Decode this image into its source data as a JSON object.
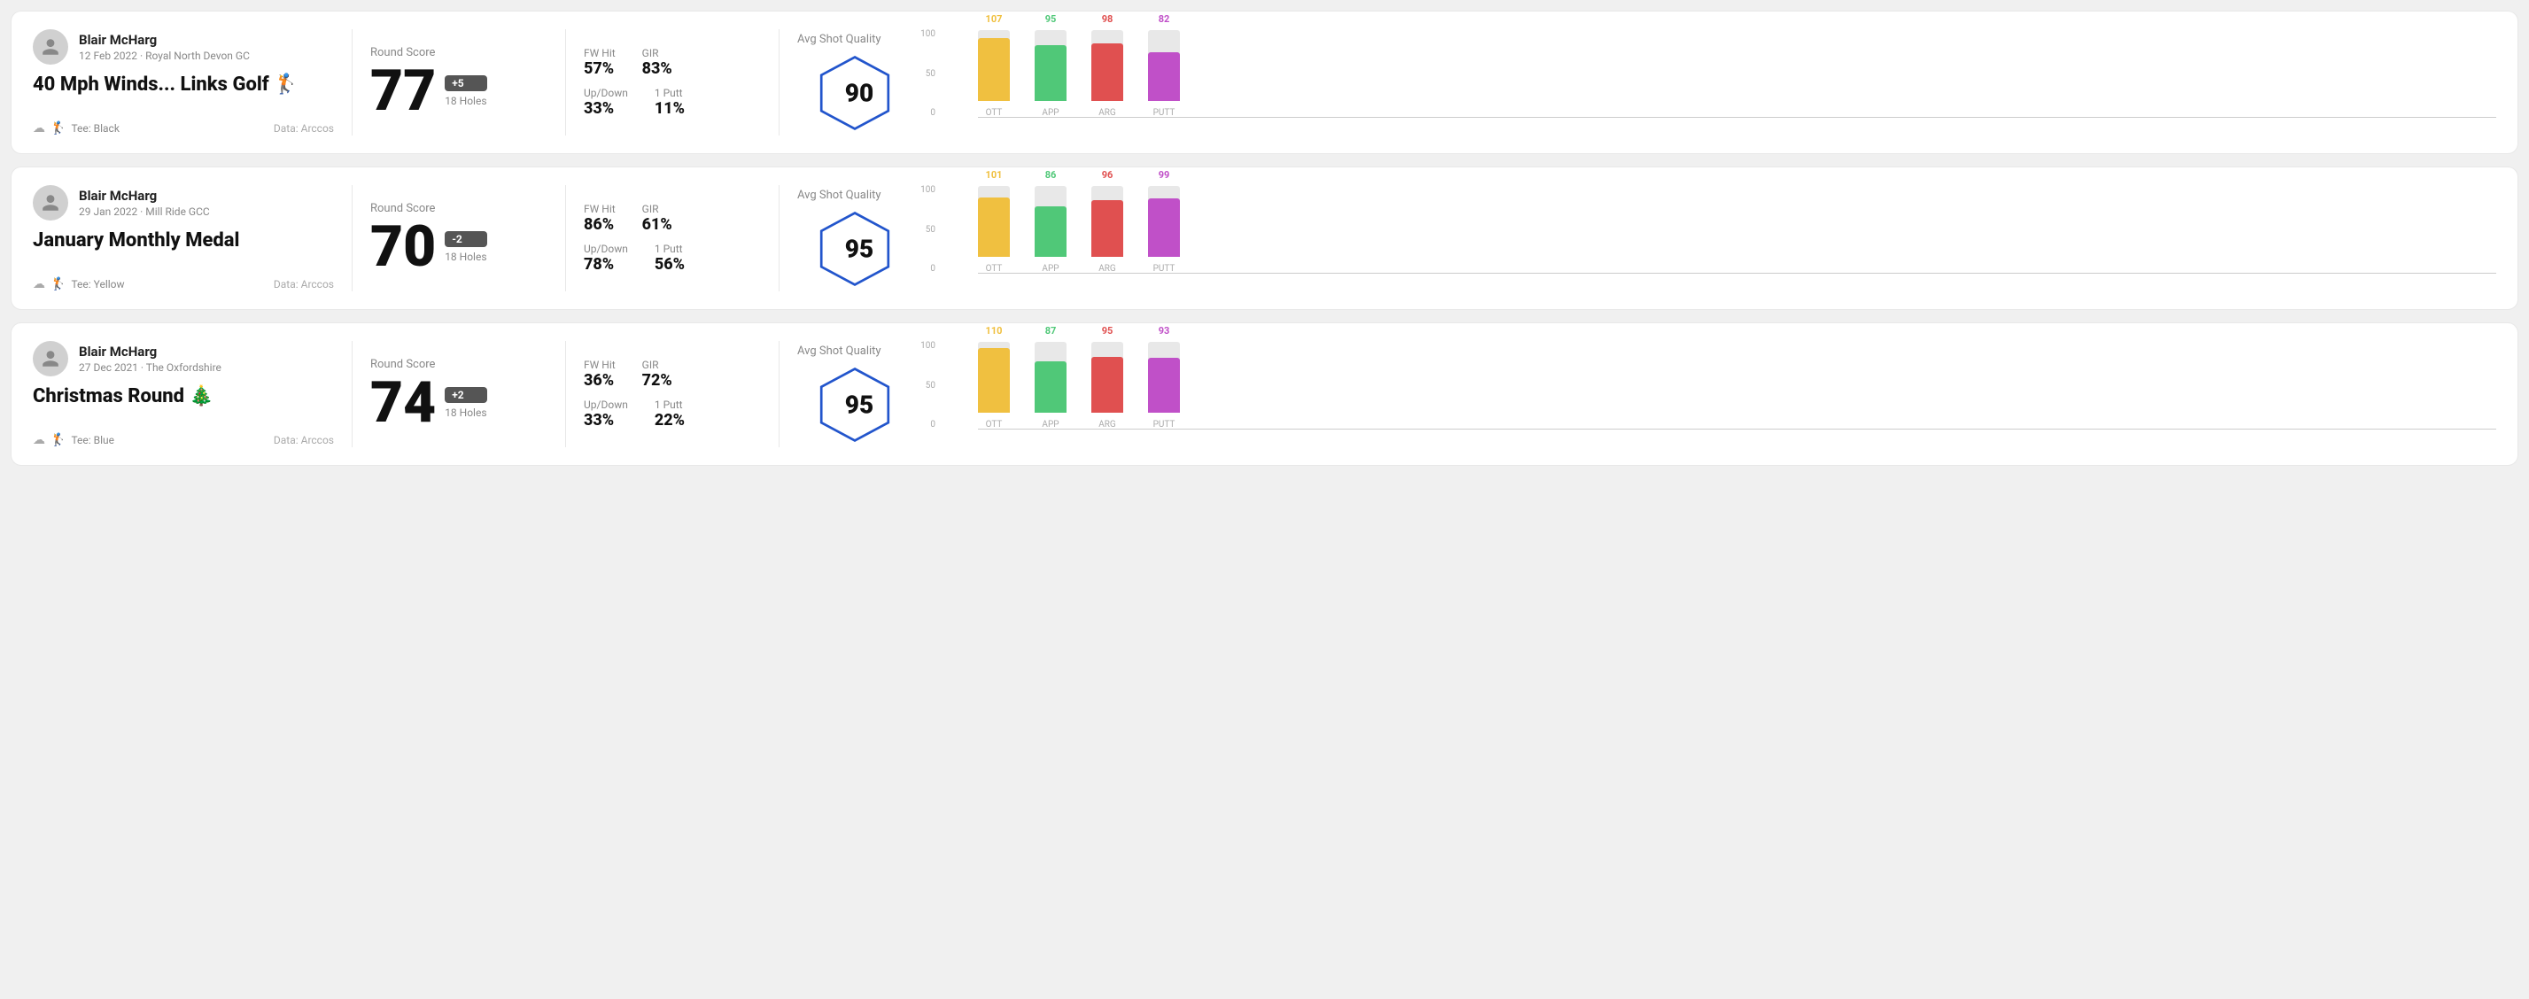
{
  "rounds": [
    {
      "id": "round-1",
      "user": {
        "name": "Blair McHarg",
        "date": "12 Feb 2022 · Royal North Devon GC",
        "tee": "Black",
        "data_source": "Data: Arccos"
      },
      "title": "40 Mph Winds... Links Golf 🏌",
      "score": "77",
      "score_diff": "+5",
      "holes": "18 Holes",
      "stats": {
        "fw_hit_label": "FW Hit",
        "fw_hit_value": "57%",
        "gir_label": "GIR",
        "gir_value": "83%",
        "updown_label": "Up/Down",
        "updown_value": "33%",
        "oneputt_label": "1 Putt",
        "oneputt_value": "11%"
      },
      "quality": {
        "label": "Avg Shot Quality",
        "score": "90"
      },
      "chart": {
        "bars": [
          {
            "label": "OTT",
            "value": 107,
            "color_class": "ott-bar",
            "text_class": "ott-color"
          },
          {
            "label": "APP",
            "value": 95,
            "color_class": "app-bar",
            "text_class": "app-color"
          },
          {
            "label": "ARG",
            "value": 98,
            "color_class": "arg-bar",
            "text_class": "arg-color"
          },
          {
            "label": "PUTT",
            "value": 82,
            "color_class": "putt-bar",
            "text_class": "putt-color"
          }
        ],
        "max": 120
      }
    },
    {
      "id": "round-2",
      "user": {
        "name": "Blair McHarg",
        "date": "29 Jan 2022 · Mill Ride GCC",
        "tee": "Yellow",
        "data_source": "Data: Arccos"
      },
      "title": "January Monthly Medal",
      "score": "70",
      "score_diff": "-2",
      "holes": "18 Holes",
      "stats": {
        "fw_hit_label": "FW Hit",
        "fw_hit_value": "86%",
        "gir_label": "GIR",
        "gir_value": "61%",
        "updown_label": "Up/Down",
        "updown_value": "78%",
        "oneputt_label": "1 Putt",
        "oneputt_value": "56%"
      },
      "quality": {
        "label": "Avg Shot Quality",
        "score": "95"
      },
      "chart": {
        "bars": [
          {
            "label": "OTT",
            "value": 101,
            "color_class": "ott-bar",
            "text_class": "ott-color"
          },
          {
            "label": "APP",
            "value": 86,
            "color_class": "app-bar",
            "text_class": "app-color"
          },
          {
            "label": "ARG",
            "value": 96,
            "color_class": "arg-bar",
            "text_class": "arg-color"
          },
          {
            "label": "PUTT",
            "value": 99,
            "color_class": "putt-bar",
            "text_class": "putt-color"
          }
        ],
        "max": 120
      }
    },
    {
      "id": "round-3",
      "user": {
        "name": "Blair McHarg",
        "date": "27 Dec 2021 · The Oxfordshire",
        "tee": "Blue",
        "data_source": "Data: Arccos"
      },
      "title": "Christmas Round 🎄",
      "score": "74",
      "score_diff": "+2",
      "holes": "18 Holes",
      "stats": {
        "fw_hit_label": "FW Hit",
        "fw_hit_value": "36%",
        "gir_label": "GIR",
        "gir_value": "72%",
        "updown_label": "Up/Down",
        "updown_value": "33%",
        "oneputt_label": "1 Putt",
        "oneputt_value": "22%"
      },
      "quality": {
        "label": "Avg Shot Quality",
        "score": "95"
      },
      "chart": {
        "bars": [
          {
            "label": "OTT",
            "value": 110,
            "color_class": "ott-bar",
            "text_class": "ott-color"
          },
          {
            "label": "APP",
            "value": 87,
            "color_class": "app-bar",
            "text_class": "app-color"
          },
          {
            "label": "ARG",
            "value": 95,
            "color_class": "arg-bar",
            "text_class": "arg-color"
          },
          {
            "label": "PUTT",
            "value": 93,
            "color_class": "putt-bar",
            "text_class": "putt-color"
          }
        ],
        "max": 120
      }
    }
  ],
  "axis_labels": [
    "100",
    "50",
    "0"
  ]
}
